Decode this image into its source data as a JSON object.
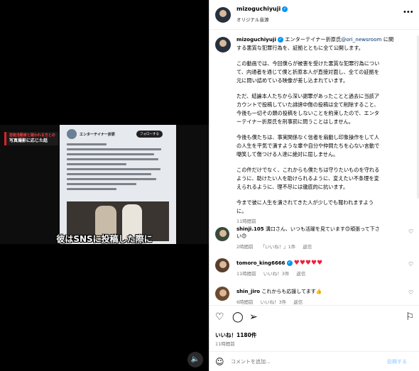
{
  "video": {
    "red_tag_line1": "芸能活動家と疑われる方との",
    "red_tag_line2": "写真撮影に応じた話",
    "mini_account": "エンターテイナー折原",
    "mini_follow": "フォローする",
    "subtitle": "彼はSNSに投稿した際に",
    "sound_icon": "🔈"
  },
  "header": {
    "username": "mizoguchiyuji",
    "verified_mark": "✓",
    "subtitle": "オリジナル音源",
    "more_icon": "•••"
  },
  "caption": {
    "username": "mizoguchiyuji",
    "verified_mark": "✓",
    "lines": [
      "エンターテイナー折原氏",
      "@ori_newsroom",
      " に関",
      "する悪質な犯罪行為を、証拠とともに全て公開します。",
      "この動画では、今回僕らが被害を受けた悪質な犯罪行為につい",
      "て、内通者を通じて僕と折原本人が直接対面し、全ての証拠を",
      "元に問い詰めている映像が差し込まれています。",
      "ただ、結論本人たちから深い謝罪があったことと過去に当該ア",
      "カウントで投稿していた誹謗中傷の投稿は全て削除すること、",
      "今後も一切その類の投稿をしないことを約束したので、エンタ",
      "ーテイナー折原氏を刑事罰に問うことはしません。",
      "今後も僕たちは、事実関係なく信者を扇動し印象操作をして人",
      "の人生を平気で潰すような輩や自分や仲間たちを心ない言動で",
      "嘲笑して傷つける人達に絶対に屈しません。",
      "この件だけでなく、これからも僕たちは守りたいものを守れる",
      "ように、助けたい人を助けられるように、変えたい不条理を変",
      "えられるように、理不尽には徹底的に抗います。",
      "今まで彼に人生を潰されてきた人が少しでも報われますよう",
      "に。"
    ],
    "time": "11時間前"
  },
  "comments": [
    {
      "username": "shinji.105",
      "text_line1": "溝口さん、いつも活躍を見ています😊頑張って下さ",
      "text_line2": "い😊",
      "time": "2時間前",
      "likes": "「いいね！」1件",
      "reply": "返信",
      "heart": "♡"
    },
    {
      "username": "tomoro_king6666",
      "verified_mark": "✓",
      "text": "♥♥♥♥♥",
      "time": "11時間前",
      "likes": "いいね！3件",
      "reply": "返信",
      "heart": "♡"
    },
    {
      "username": "shin_jiro",
      "text": "これからも応援してます👍",
      "time": "6時間前",
      "likes": "いいね！3件",
      "reply": "返信",
      "heart": "♡"
    }
  ],
  "actions": {
    "like_icon": "♡",
    "comment_icon": "◯",
    "share_icon": "➢",
    "save_icon": "⚐",
    "likes_text": "いいね！1180件",
    "post_time": "11時間前"
  },
  "comment_box": {
    "emoji_icon": "☺",
    "placeholder": "コメントを追加...",
    "post_label": "投稿する"
  }
}
